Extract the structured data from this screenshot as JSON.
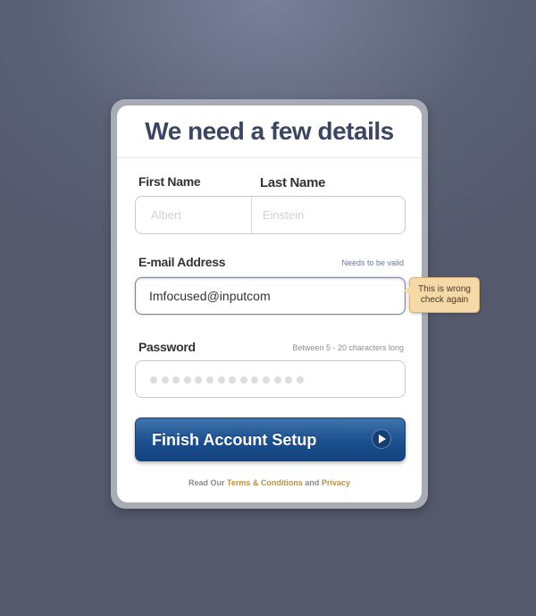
{
  "title": "We need a few details",
  "first_name": {
    "label": "First Name",
    "placeholder": "Albert"
  },
  "last_name": {
    "label": "Last Name",
    "placeholder": "Einstein"
  },
  "email": {
    "label": "E-mail Address",
    "hint": "Needs to be valid",
    "value": "Imfocused@inputcom",
    "tooltip_line1": "This is wrong",
    "tooltip_line2": "check again"
  },
  "password": {
    "label": "Password",
    "hint": "Between 5 - 20 characters long",
    "masked_length": 14
  },
  "submit": {
    "label": "Finish Account Setup",
    "icon": "play-arrow-icon"
  },
  "footer": {
    "prefix": "Read Our",
    "terms": "Terms & Conditions",
    "and": "and",
    "privacy": "Privacy"
  },
  "colors": {
    "title": "#3d4660",
    "button": "#1c4f8e",
    "link": "#b8924a",
    "tooltip": "#f6d9a9"
  }
}
